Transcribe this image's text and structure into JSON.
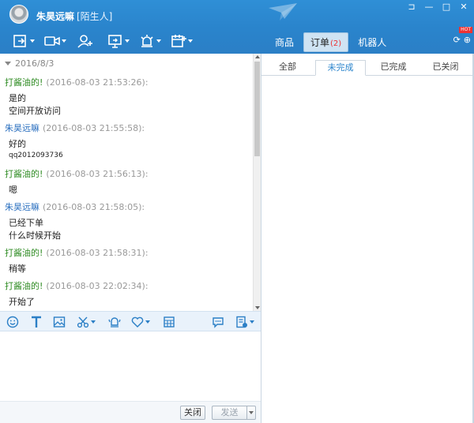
{
  "header": {
    "contact_name": "朱昊远嘛",
    "contact_tag": "[陌生人]",
    "window_buttons": [
      "⊐",
      "—",
      "□",
      "✕"
    ]
  },
  "toolbar": {
    "icons": [
      "transfer-file-icon",
      "video-call-icon",
      "add-contact-icon",
      "screen-share-icon",
      "alert-icon",
      "schedule-icon"
    ]
  },
  "right_tabs": [
    {
      "label": "商品"
    },
    {
      "label": "订单",
      "badge": "(2)",
      "active": true
    },
    {
      "label": "机器人"
    }
  ],
  "hot_badge": "HOT",
  "chat": {
    "date": "2016/8/3",
    "messages": [
      {
        "sender": "打酱油的!",
        "time": "(2016-08-03 21:53:26):",
        "lines": [
          "是的",
          "空间开放访问"
        ]
      },
      {
        "sender": "朱昊远嘛",
        "time": "(2016-08-03 21:55:58):",
        "lines": [
          "好的",
          "qq2012093736"
        ]
      },
      {
        "sender": "打酱油的!",
        "time": "(2016-08-03 21:56:13):",
        "lines": [
          "嗯"
        ]
      },
      {
        "sender": "朱昊远嘛",
        "time": "(2016-08-03 21:58:05):",
        "lines": [
          "已经下单",
          "什么时候开始"
        ]
      },
      {
        "sender": "打酱油的!",
        "time": "(2016-08-03 21:58:31):",
        "lines": [
          "稍等"
        ]
      },
      {
        "sender": "打酱油的!",
        "time": "(2016-08-03 22:02:34):",
        "lines": [
          "开始了"
        ]
      }
    ]
  },
  "buttons": {
    "close_label": "关闭",
    "send_label": "发送"
  },
  "order_tabs": [
    "全部",
    "未完成",
    "已完成",
    "已关闭"
  ],
  "colors": {
    "header_blue": "#2a84cc",
    "seller_green": "#2e8b22",
    "buyer_blue": "#2a6fbf"
  }
}
